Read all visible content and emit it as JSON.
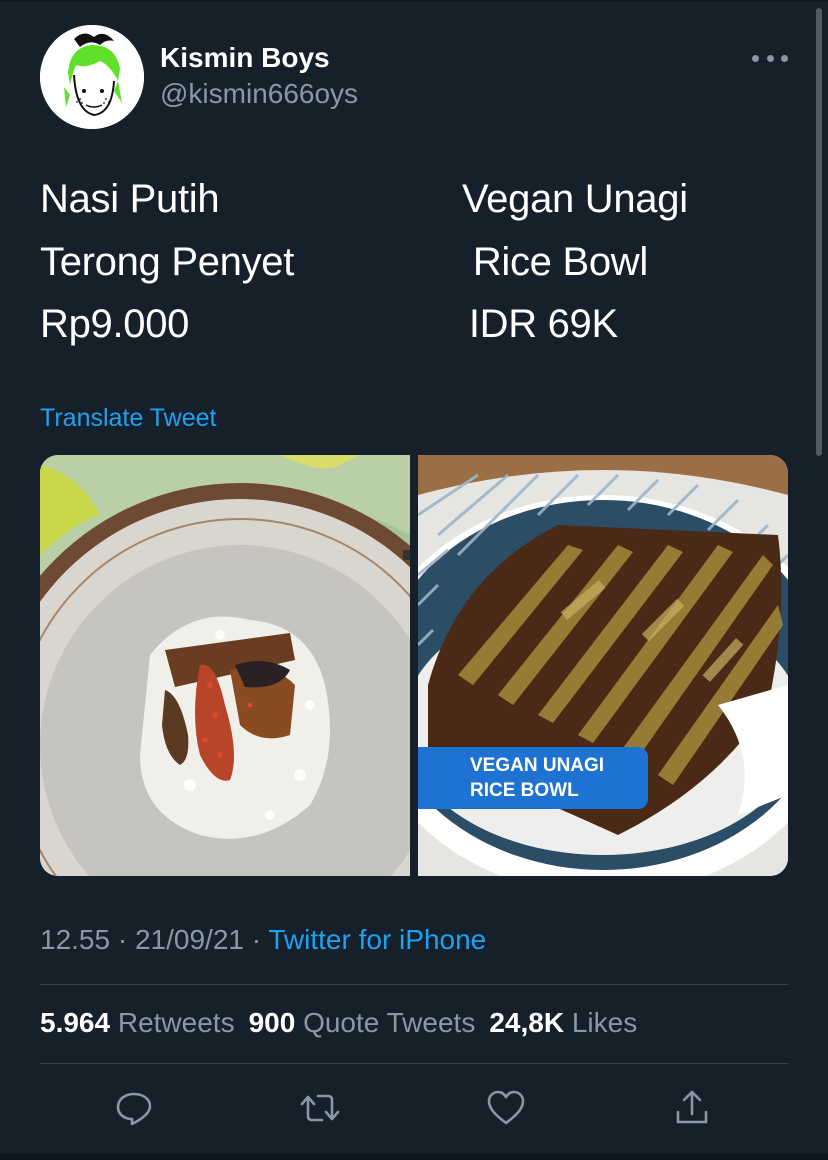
{
  "tweet": {
    "author_name": "Kismin Boys",
    "author_handle": "@kismin666oys",
    "lines_left": [
      "Nasi Putih",
      "Terong Penyet",
      "Rp9.000"
    ],
    "lines_right": [
      "Vegan Unagi",
      " Rice Bowl",
      " IDR 69K"
    ],
    "translate_label": "Translate Tweet",
    "image_overlay": {
      "line1": "VEGAN UNAGI",
      "line2": "RICE BOWL"
    }
  },
  "meta": {
    "time": "12.55",
    "date": "21/09/21",
    "separator": " · ",
    "source": "Twitter for iPhone"
  },
  "stats": {
    "retweets_count": "5.964",
    "retweets_label": "Retweets",
    "quotes_count": "900",
    "quotes_label": "Quote Tweets",
    "likes_count": "24,8K",
    "likes_label": "Likes"
  },
  "actions": [
    "reply-icon",
    "retweet-icon",
    "like-icon",
    "share-icon"
  ],
  "colors": {
    "background": "#15202b",
    "link": "#1da1f2",
    "secondary_text": "#8899a6",
    "overlay_badge": "#1e73d2"
  }
}
